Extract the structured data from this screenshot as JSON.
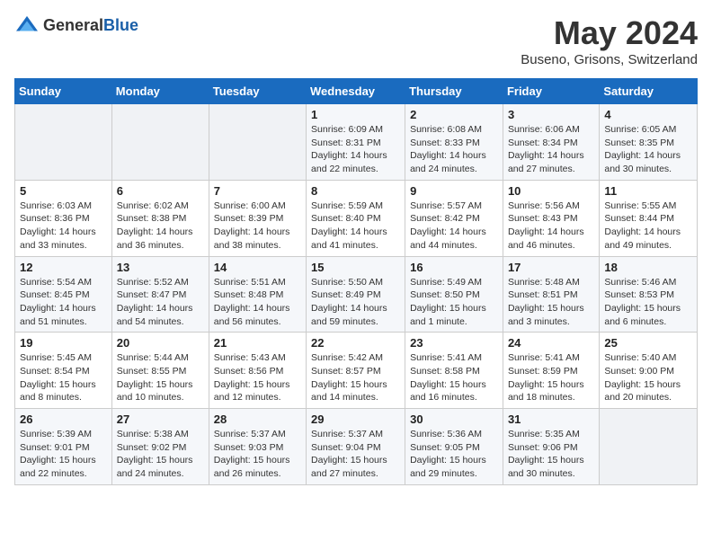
{
  "header": {
    "logo_general": "General",
    "logo_blue": "Blue",
    "month_year": "May 2024",
    "location": "Buseno, Grisons, Switzerland"
  },
  "weekdays": [
    "Sunday",
    "Monday",
    "Tuesday",
    "Wednesday",
    "Thursday",
    "Friday",
    "Saturday"
  ],
  "weeks": [
    [
      {
        "day": "",
        "info": ""
      },
      {
        "day": "",
        "info": ""
      },
      {
        "day": "",
        "info": ""
      },
      {
        "day": "1",
        "info": "Sunrise: 6:09 AM\nSunset: 8:31 PM\nDaylight: 14 hours\nand 22 minutes."
      },
      {
        "day": "2",
        "info": "Sunrise: 6:08 AM\nSunset: 8:33 PM\nDaylight: 14 hours\nand 24 minutes."
      },
      {
        "day": "3",
        "info": "Sunrise: 6:06 AM\nSunset: 8:34 PM\nDaylight: 14 hours\nand 27 minutes."
      },
      {
        "day": "4",
        "info": "Sunrise: 6:05 AM\nSunset: 8:35 PM\nDaylight: 14 hours\nand 30 minutes."
      }
    ],
    [
      {
        "day": "5",
        "info": "Sunrise: 6:03 AM\nSunset: 8:36 PM\nDaylight: 14 hours\nand 33 minutes."
      },
      {
        "day": "6",
        "info": "Sunrise: 6:02 AM\nSunset: 8:38 PM\nDaylight: 14 hours\nand 36 minutes."
      },
      {
        "day": "7",
        "info": "Sunrise: 6:00 AM\nSunset: 8:39 PM\nDaylight: 14 hours\nand 38 minutes."
      },
      {
        "day": "8",
        "info": "Sunrise: 5:59 AM\nSunset: 8:40 PM\nDaylight: 14 hours\nand 41 minutes."
      },
      {
        "day": "9",
        "info": "Sunrise: 5:57 AM\nSunset: 8:42 PM\nDaylight: 14 hours\nand 44 minutes."
      },
      {
        "day": "10",
        "info": "Sunrise: 5:56 AM\nSunset: 8:43 PM\nDaylight: 14 hours\nand 46 minutes."
      },
      {
        "day": "11",
        "info": "Sunrise: 5:55 AM\nSunset: 8:44 PM\nDaylight: 14 hours\nand 49 minutes."
      }
    ],
    [
      {
        "day": "12",
        "info": "Sunrise: 5:54 AM\nSunset: 8:45 PM\nDaylight: 14 hours\nand 51 minutes."
      },
      {
        "day": "13",
        "info": "Sunrise: 5:52 AM\nSunset: 8:47 PM\nDaylight: 14 hours\nand 54 minutes."
      },
      {
        "day": "14",
        "info": "Sunrise: 5:51 AM\nSunset: 8:48 PM\nDaylight: 14 hours\nand 56 minutes."
      },
      {
        "day": "15",
        "info": "Sunrise: 5:50 AM\nSunset: 8:49 PM\nDaylight: 14 hours\nand 59 minutes."
      },
      {
        "day": "16",
        "info": "Sunrise: 5:49 AM\nSunset: 8:50 PM\nDaylight: 15 hours\nand 1 minute."
      },
      {
        "day": "17",
        "info": "Sunrise: 5:48 AM\nSunset: 8:51 PM\nDaylight: 15 hours\nand 3 minutes."
      },
      {
        "day": "18",
        "info": "Sunrise: 5:46 AM\nSunset: 8:53 PM\nDaylight: 15 hours\nand 6 minutes."
      }
    ],
    [
      {
        "day": "19",
        "info": "Sunrise: 5:45 AM\nSunset: 8:54 PM\nDaylight: 15 hours\nand 8 minutes."
      },
      {
        "day": "20",
        "info": "Sunrise: 5:44 AM\nSunset: 8:55 PM\nDaylight: 15 hours\nand 10 minutes."
      },
      {
        "day": "21",
        "info": "Sunrise: 5:43 AM\nSunset: 8:56 PM\nDaylight: 15 hours\nand 12 minutes."
      },
      {
        "day": "22",
        "info": "Sunrise: 5:42 AM\nSunset: 8:57 PM\nDaylight: 15 hours\nand 14 minutes."
      },
      {
        "day": "23",
        "info": "Sunrise: 5:41 AM\nSunset: 8:58 PM\nDaylight: 15 hours\nand 16 minutes."
      },
      {
        "day": "24",
        "info": "Sunrise: 5:41 AM\nSunset: 8:59 PM\nDaylight: 15 hours\nand 18 minutes."
      },
      {
        "day": "25",
        "info": "Sunrise: 5:40 AM\nSunset: 9:00 PM\nDaylight: 15 hours\nand 20 minutes."
      }
    ],
    [
      {
        "day": "26",
        "info": "Sunrise: 5:39 AM\nSunset: 9:01 PM\nDaylight: 15 hours\nand 22 minutes."
      },
      {
        "day": "27",
        "info": "Sunrise: 5:38 AM\nSunset: 9:02 PM\nDaylight: 15 hours\nand 24 minutes."
      },
      {
        "day": "28",
        "info": "Sunrise: 5:37 AM\nSunset: 9:03 PM\nDaylight: 15 hours\nand 26 minutes."
      },
      {
        "day": "29",
        "info": "Sunrise: 5:37 AM\nSunset: 9:04 PM\nDaylight: 15 hours\nand 27 minutes."
      },
      {
        "day": "30",
        "info": "Sunrise: 5:36 AM\nSunset: 9:05 PM\nDaylight: 15 hours\nand 29 minutes."
      },
      {
        "day": "31",
        "info": "Sunrise: 5:35 AM\nSunset: 9:06 PM\nDaylight: 15 hours\nand 30 minutes."
      },
      {
        "day": "",
        "info": ""
      }
    ]
  ]
}
